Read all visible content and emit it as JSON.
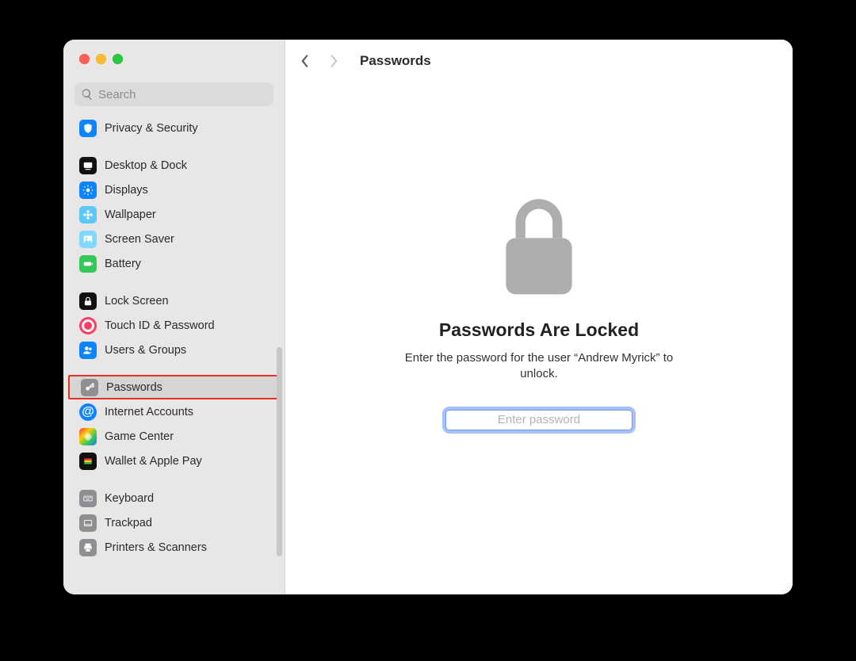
{
  "search": {
    "placeholder": "Search"
  },
  "header": {
    "title": "Passwords"
  },
  "sidebar": {
    "items": [
      {
        "id": "privacy-security",
        "label": "Privacy & Security",
        "icon": "shield",
        "ic": "ic-privacy"
      },
      {
        "gap": true
      },
      {
        "id": "desktop-dock",
        "label": "Desktop & Dock",
        "icon": "dock",
        "ic": "ic-desktop"
      },
      {
        "id": "displays",
        "label": "Displays",
        "icon": "sun",
        "ic": "ic-displays"
      },
      {
        "id": "wallpaper",
        "label": "Wallpaper",
        "icon": "flower",
        "ic": "ic-wallpaper"
      },
      {
        "id": "screen-saver",
        "label": "Screen Saver",
        "icon": "photo",
        "ic": "ic-screensave"
      },
      {
        "id": "battery",
        "label": "Battery",
        "icon": "battery",
        "ic": "ic-battery"
      },
      {
        "gap": true
      },
      {
        "id": "lock-screen",
        "label": "Lock Screen",
        "icon": "lock",
        "ic": "ic-lock"
      },
      {
        "id": "touch-id-password",
        "label": "Touch ID & Password",
        "icon": "fingerprint",
        "ic": "ic-touchid"
      },
      {
        "id": "users-groups",
        "label": "Users & Groups",
        "icon": "people",
        "ic": "ic-users"
      },
      {
        "gap": true
      },
      {
        "id": "passwords",
        "label": "Passwords",
        "icon": "key",
        "ic": "ic-passwords",
        "selected": true,
        "highlight": true
      },
      {
        "id": "internet-accounts",
        "label": "Internet Accounts",
        "icon": "at",
        "ic": "ic-internet"
      },
      {
        "id": "game-center",
        "label": "Game Center",
        "icon": "game",
        "ic": "ic-gamecenter"
      },
      {
        "id": "wallet-apple-pay",
        "label": "Wallet & Apple Pay",
        "icon": "wallet",
        "ic": "ic-wallet"
      },
      {
        "gap": true
      },
      {
        "id": "keyboard",
        "label": "Keyboard",
        "icon": "keyboard",
        "ic": "ic-keyboard"
      },
      {
        "id": "trackpad",
        "label": "Trackpad",
        "icon": "trackpad",
        "ic": "ic-trackpad"
      },
      {
        "id": "printers-scanners",
        "label": "Printers & Scanners",
        "icon": "printer",
        "ic": "ic-printers"
      }
    ]
  },
  "locked": {
    "heading": "Passwords Are Locked",
    "subtitle": "Enter the password for the user “Andrew Myrick” to unlock.",
    "placeholder": "Enter password"
  }
}
